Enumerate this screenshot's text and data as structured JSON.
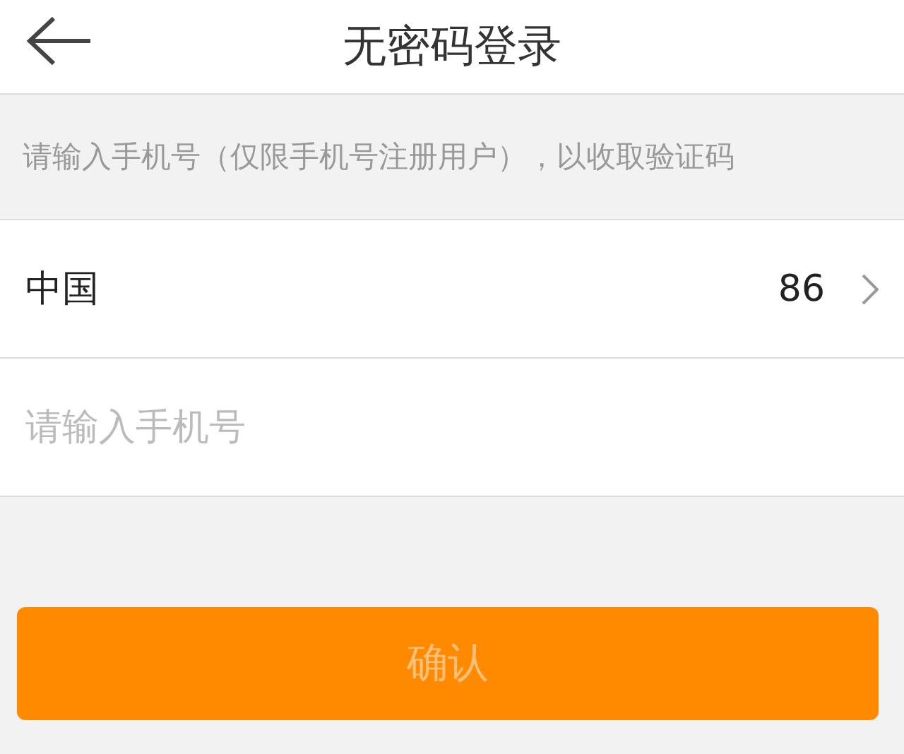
{
  "header": {
    "title": "无密码登录"
  },
  "hint": "请输入手机号（仅限手机号注册用户），以收取验证码",
  "country": {
    "name": "中国",
    "code": "86"
  },
  "phone": {
    "placeholder": "请输入手机号"
  },
  "confirm": {
    "label": "确认",
    "disabled": true
  }
}
